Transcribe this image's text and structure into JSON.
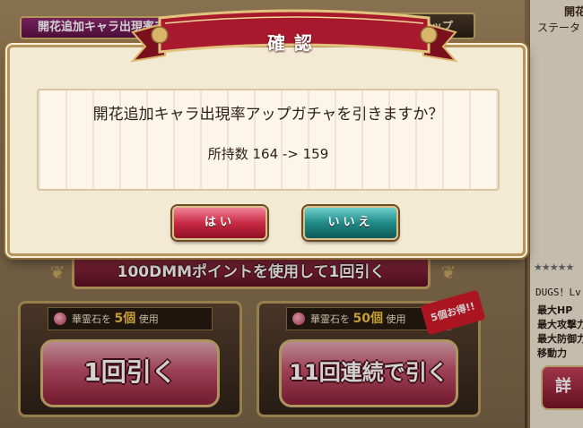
{
  "background": {
    "gacha_title": "開花追加キャラ出現率アップガチャ",
    "lineup_button": "ガチャラインナップ",
    "dmm_button": "100DMMポイントを使用して1回引く",
    "single": {
      "cost_prefix": "華霊石を",
      "cost_num": "5個",
      "cost_suffix": "使用",
      "button": "1回引く"
    },
    "multi": {
      "cost_prefix": "華霊石を",
      "cost_num": "50個",
      "cost_suffix": "使用",
      "button": "11回連続で引く",
      "badge": "5個お得!!"
    }
  },
  "side_panel": {
    "name": "開花",
    "status_label": "ステータ",
    "stars": "★★★★★",
    "level": "DUGS！Lv.",
    "stats": [
      "最大HP",
      "最大攻撃力",
      "最大防御力",
      "移動力"
    ],
    "button": "詳"
  },
  "dialog": {
    "title": "確認",
    "question": "開花追加キャラ出現率アップガチャを引きますか？",
    "count": "所持数 164 -> 159",
    "yes_label": "はい",
    "no_label": "いいえ"
  },
  "colors": {
    "yes": "#c82a45",
    "no": "#1f8a87",
    "ribbon": "#a8192e",
    "frame": "#b5945a"
  }
}
